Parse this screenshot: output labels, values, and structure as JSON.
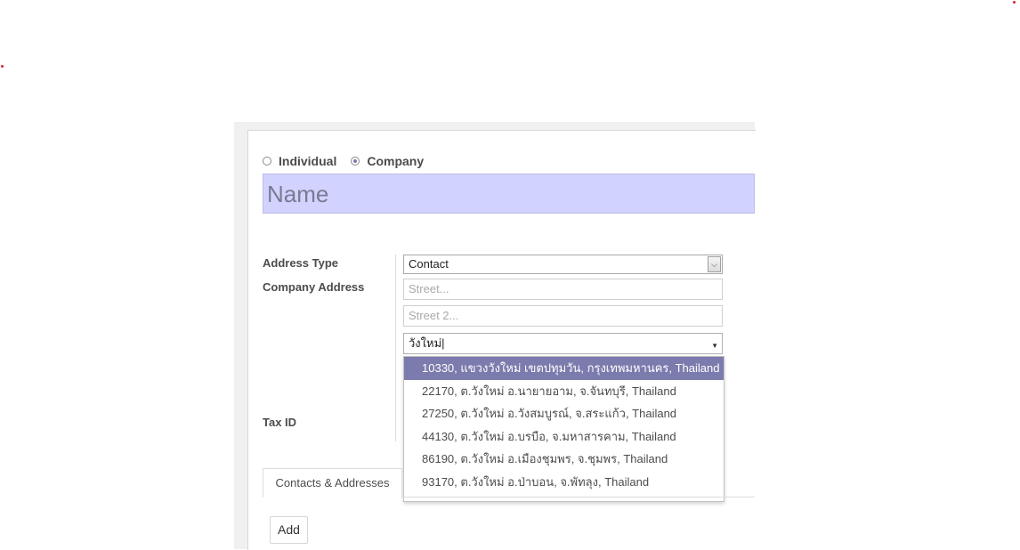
{
  "partner_type": {
    "individual_label": "Individual",
    "company_label": "Company",
    "selected": "company"
  },
  "name_field": {
    "placeholder": "Name"
  },
  "labels": {
    "address_type": "Address Type",
    "company_address": "Company Address",
    "tax_id": "Tax ID"
  },
  "address_type": {
    "value": "Contact"
  },
  "address": {
    "street_placeholder": "Street...",
    "street2_placeholder": "Street 2...",
    "search_value": "วังใหม่"
  },
  "dropdown": {
    "items": [
      "10330, แขวงวังใหม่ เขตปทุมวัน, กรุงเทพมหานคร, Thailand",
      "22170, ต.วังใหม่ อ.นายายอาม, จ.จันทบุรี, Thailand",
      "27250, ต.วังใหม่ อ.วังสมบูรณ์, จ.สระแก้ว, Thailand",
      "44130, ต.วังใหม่ อ.บรบือ, จ.มหาสารคาม, Thailand",
      "86190, ต.วังใหม่ อ.เมืองชุมพร, จ.ชุมพร, Thailand",
      "93170, ต.วังใหม่ อ.ป่าบอน, จ.พัทลุง, Thailand"
    ],
    "selected_index": 0
  },
  "tabs": {
    "contacts_addresses": "Contacts & Addresses"
  },
  "buttons": {
    "add": "Add"
  },
  "colors": {
    "accent": "#7c7bad",
    "name_bg": "#d2d2ff"
  }
}
